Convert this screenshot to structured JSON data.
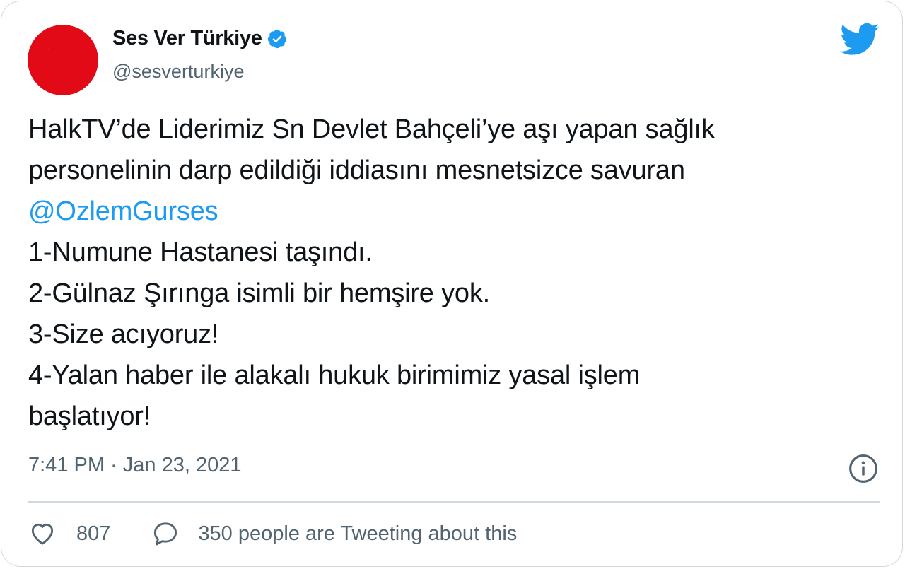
{
  "account": {
    "name": "Ses Ver Türkiye",
    "handle": "@sesverturkiye",
    "verified_icon": "verified-badge",
    "avatar_icon": "mhp-crescents-logo"
  },
  "tweet": {
    "lines": {
      "l1": "HalkTV’de Liderimiz Sn Devlet Bahçeli’ye aşı yapan sağlık",
      "l2": "personelinin darp edildiği iddiasını mesnetsizce savuran",
      "l3": "@OzlemGurses",
      "l4": "1-Numune Hastanesi taşındı.",
      "l5": "2-Gülnaz Şırınga isimli bir hemşire yok.",
      "l6": "3-Size acıyoruz!",
      "l7": "4-Yalan haber ile alakalı hukuk birimimiz yasal işlem",
      "l8": "başlatıyor!"
    },
    "timestamp": "7:41 PM · Jan 23, 2021"
  },
  "footer": {
    "like_count": "807",
    "reply_text": "350 people are Tweeting about this"
  },
  "colors": {
    "accent": "#1d9bf0",
    "text": "#0f1419",
    "muted": "#536471",
    "border": "#cfd9de",
    "logo_red": "#e30a17"
  }
}
